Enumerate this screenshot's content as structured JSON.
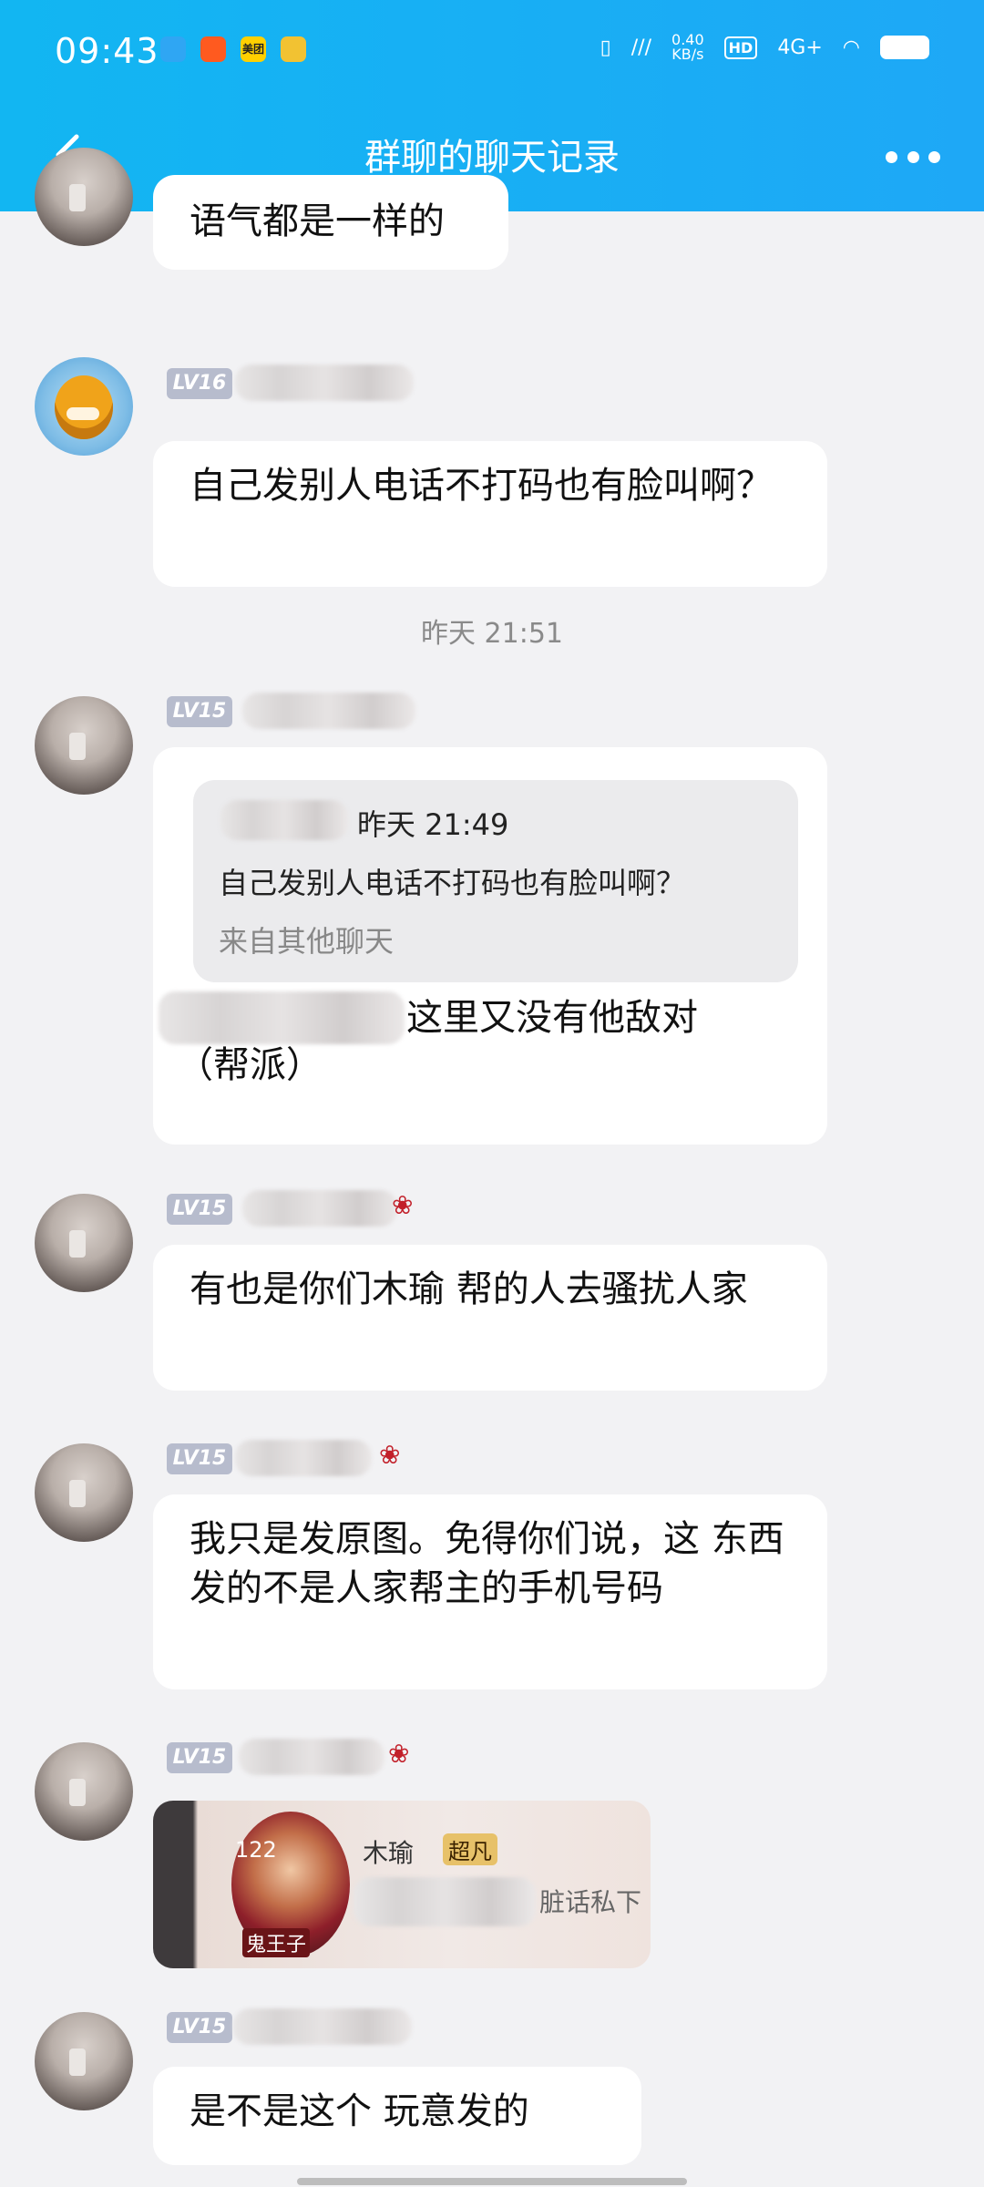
{
  "status_bar": {
    "time": "09:43",
    "app_icons": [
      {
        "icon": "app-notify-icon",
        "color": "#2fa6f3"
      },
      {
        "icon": "taobao-icon",
        "color": "#ff5a1f"
      },
      {
        "icon": "meituan-icon",
        "label": "美团",
        "color": "#ffd000"
      },
      {
        "icon": "qqmusic-icon",
        "color": "#f2c232"
      }
    ],
    "network_speed": "0.40",
    "network_speed_unit": "KB/s",
    "hd_label": "HD",
    "network_type": "4G+"
  },
  "header": {
    "title": "群聊的聊天记录"
  },
  "messages": [
    {
      "text": "语气都是一样的"
    },
    {
      "level": "LV16",
      "text": "自己发别人电话不打码也有脸叫啊？"
    },
    {
      "timestamp": "昨天 21:51"
    },
    {
      "level": "LV15",
      "quote": {
        "time": "昨天 21:49",
        "text": "自己发别人电话不打码也有脸叫啊？",
        "source": "来自其他聊天"
      },
      "text_visible": "这里又没有他敌对",
      "text_line2": "（帮派）"
    },
    {
      "level": "LV15",
      "text": "有也是你们木瑜 帮的人去骚扰人家"
    },
    {
      "level": "LV15",
      "text": "我只是发原图。免得你们说，这 东西发的不是人家帮主的手机号码"
    },
    {
      "level": "LV15",
      "image": {
        "num": "122",
        "name": "木瑜",
        "tag": "超凡",
        "chat_text": "脏话私下",
        "badge": "鬼王子"
      }
    },
    {
      "level": "LV15",
      "text": "是不是这个 玩意发的"
    }
  ]
}
